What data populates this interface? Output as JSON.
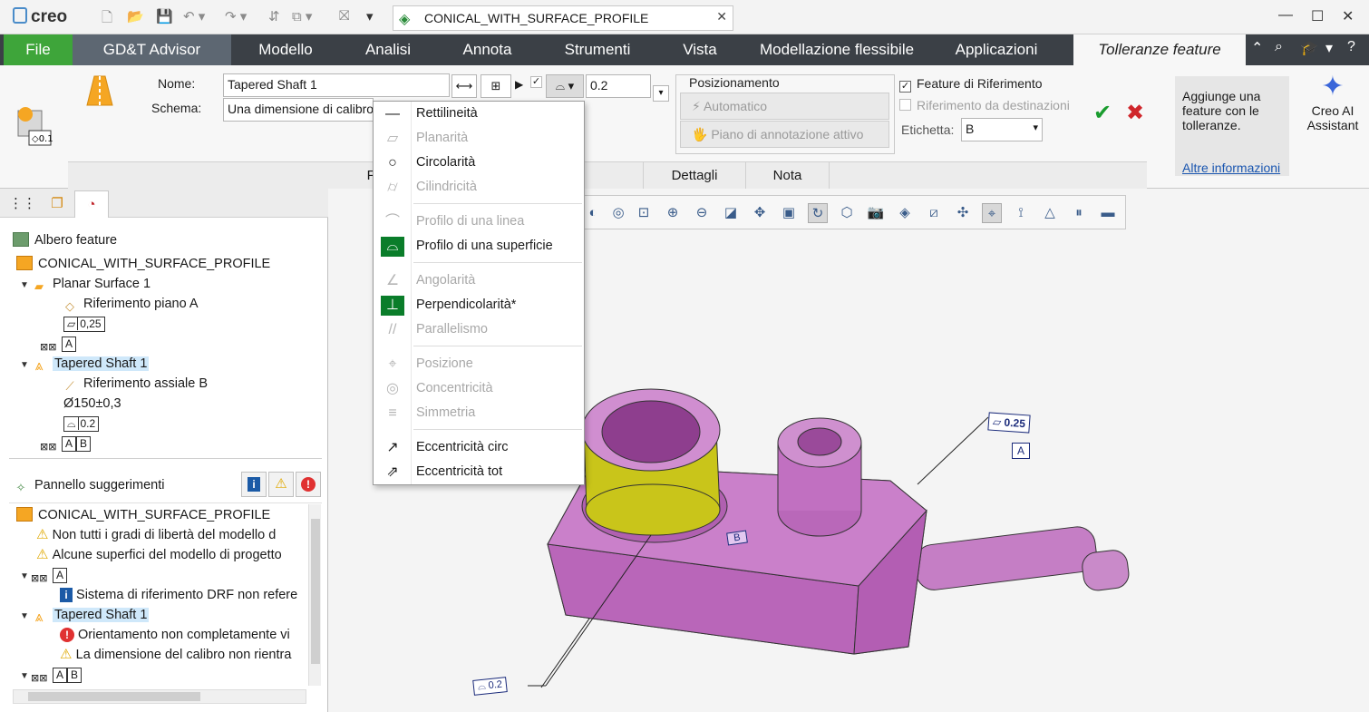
{
  "titlebar": {
    "brand": "creo",
    "document_title": "CONICAL_WITH_SURFACE_PROFILE"
  },
  "ribbon_tabs": {
    "file": "File",
    "gdt_advisor": "GD&T Advisor",
    "modello": "Modello",
    "analisi": "Analisi",
    "annota": "Annota",
    "strumenti": "Strumenti",
    "vista": "Vista",
    "flessibile": "Modellazione flessibile",
    "applicazioni": "Applicazioni",
    "active": "Tolleranze feature"
  },
  "ribbon": {
    "nome_label": "Nome:",
    "nome_value": "Tapered Shaft 1",
    "schema_label": "Schema:",
    "schema_value": "Una dimensione di calibro",
    "tolerance_value": "0.2",
    "posizionamento_title": "Posizionamento",
    "automatico": "Automatico",
    "piano_annotazione": "Piano di annotazione attivo",
    "feature_riferimento": "Feature di Riferimento",
    "riferimento_destinazioni": "Riferimento da destinazioni",
    "etichetta_label": "Etichetta:",
    "etichetta_value": "B",
    "help_text": "Aggiunge una feature con le tolleranze.",
    "help_link": "Altre informazioni",
    "ai_label_1": "Creo AI",
    "ai_label_2": "Assistant",
    "subtab_feature": "Feature",
    "subtab_relazioni": "Relazioni",
    "subtab_dettagli": "Dettagli",
    "subtab_nota": "Nota"
  },
  "feature_tree": {
    "header": "Albero feature",
    "root": "CONICAL_WITH_SURFACE_PROFILE",
    "planar": "Planar Surface 1",
    "rif_piano": "Riferimento piano A",
    "planar_tol": "0,25",
    "ref_a": "A",
    "tapered": "Tapered Shaft 1",
    "rif_assiale": "Riferimento assiale B",
    "diameter": "Ø150±0,3",
    "profile_tol": "0.2",
    "ref_ab_a": "A",
    "ref_ab_b": "B"
  },
  "suggestions": {
    "header": "Pannello suggerimenti",
    "root": "CONICAL_WITH_SURFACE_PROFILE",
    "w1": "Non tutti i gradi di libertà del modello d",
    "w2": "Alcune superfici del modello di progetto",
    "ref_a": "A",
    "i1": "Sistema di riferimento DRF non refere",
    "tapered": "Tapered Shaft 1",
    "e1": "Orientamento non completamente vi",
    "w3": "La dimensione del calibro non rientra",
    "ref_ab_a": "A",
    "ref_ab_b": "B"
  },
  "dropdown": {
    "items": [
      {
        "label": "Rettilineità",
        "enabled": true
      },
      {
        "label": "Planarità",
        "enabled": false
      },
      {
        "label": "Circolarità",
        "enabled": true
      },
      {
        "label": "Cilindricità",
        "enabled": false
      },
      {
        "label": "Profilo di una linea",
        "enabled": false
      },
      {
        "label": "Profilo di una superficie",
        "enabled": true
      },
      {
        "label": "Angolarità",
        "enabled": false
      },
      {
        "label": "Perpendicolarità*",
        "enabled": true
      },
      {
        "label": "Parallelismo",
        "enabled": false
      },
      {
        "label": "Posizione",
        "enabled": false
      },
      {
        "label": "Concentricità",
        "enabled": false
      },
      {
        "label": "Simmetria",
        "enabled": false
      },
      {
        "label": "Eccentricità circ",
        "enabled": true
      },
      {
        "label": "Eccentricità tot",
        "enabled": true
      }
    ]
  },
  "model_annotations": {
    "flatness_tol": "0.25",
    "datum_a": "A",
    "datum_b": "B",
    "profile_tol": "0.2"
  },
  "colors": {
    "accent_green": "#3ea53a",
    "tab_dark": "#3b4046",
    "part_pink": "#c877c8",
    "selected_yellow": "#c8c800"
  }
}
